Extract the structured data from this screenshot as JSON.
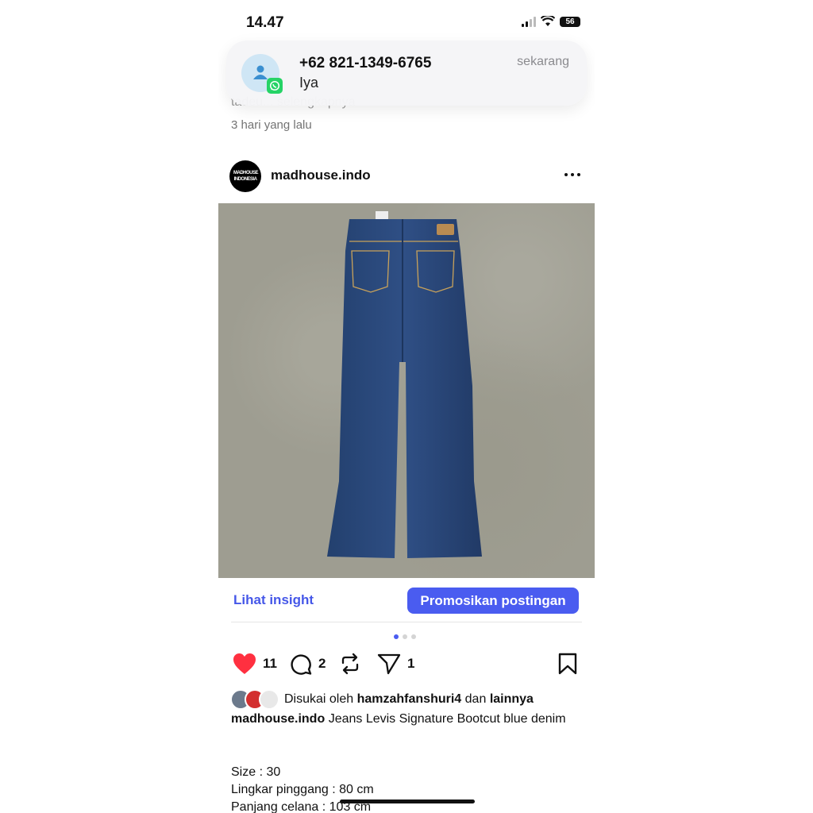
{
  "status_bar": {
    "time": "14.47",
    "battery": "56"
  },
  "notification": {
    "title": "+62 821-1349-6765",
    "message": "Iya",
    "time": "sekarang"
  },
  "previous_post": {
    "caption_fragment": "tadeu... selengkapnya",
    "time": "3 hari yang lalu"
  },
  "post": {
    "username": "madhouse.indo",
    "avatar_text": "MADHOUSE INDONESIA",
    "insight_label": "Lihat insight",
    "promote_label": "Promosikan postingan",
    "likes_count": "11",
    "comments_count": "2",
    "shares_count": "1",
    "liked_by_prefix": "Disukai oleh",
    "liked_by_user": "hamzahfanshuri4",
    "liked_by_and": "dan",
    "liked_by_others": "lainnya",
    "caption_user": "madhouse.indo",
    "caption_text": "Jeans Levis Signature Bootcut blue denim",
    "details": [
      "Size : 30",
      "Lingkar pinggang : 80 cm",
      "Panjang celana : 103 cm"
    ]
  },
  "colors": {
    "accent": "#4a5cf0",
    "like": "#ff3040",
    "denim": "#2e4a7a"
  }
}
